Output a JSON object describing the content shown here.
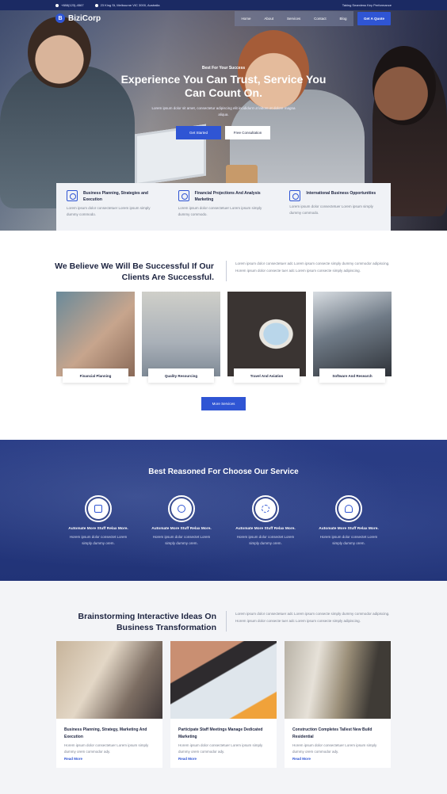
{
  "topbar": {
    "phone": "+888(123)-4567",
    "address": "23 King St, Melbourne VIC 3000, Australia",
    "tagline": "Taking Seamless Key Performance"
  },
  "nav": {
    "logo_letter": "B",
    "logo_text": "BiziCorp",
    "items": [
      "Home",
      "About",
      "Services",
      "Contact",
      "Blog"
    ],
    "cta": "Get A Quote"
  },
  "hero": {
    "eyebrow": "Best For Your Success",
    "title": "Experience You Can Trust, Service You Can Count On.",
    "subtitle": "Lorem ipsum dolor sit amet, consectetur adipiscing elit incididunt ut labore et dolore magna aliqua.",
    "primary_btn": "Get Started",
    "secondary_btn": "Free Consultation"
  },
  "features": [
    {
      "title": "Business Planning, Strategies and Execution",
      "text": "Lorem ipsum dolor consectetuer Lorem ipsum simply dummy commodo."
    },
    {
      "title": "Financial Projections And Analysis Marketing",
      "text": "Lorem ipsum dolor consectetuer Lorem ipsum simply dummy commodo."
    },
    {
      "title": "International Business Opportunities",
      "text": "Lorem ipsum dolor consectetuer Lorem ipsum simply dummy commodo."
    }
  ],
  "about": {
    "title": "We Believe We Will Be Successful If Our Clients Are Successful.",
    "text": "Lorem ipsum dolor consectetuer adc Lorem ipsum consecte simply dummy commodor adipiscing. Horem ipsum dolor consecte tuer adc Lorem ipsum consecte simply adipiscing."
  },
  "services_cards": [
    "Financial Planning",
    "Quality Resourcing",
    "Travel And Aviation",
    "Software And Research"
  ],
  "more_services_btn": "More Services",
  "choose": {
    "title": "Best Reasoned For Choose Our Service",
    "items": [
      {
        "title": "Automate More Stuff Relax More.",
        "text": "Horem ipsum dolor consectet Lorem simply dummy orem."
      },
      {
        "title": "Automate More Stuff Relax More.",
        "text": "Horem ipsum dolor consectet Lorem simply dummy orem."
      },
      {
        "title": "Automate More Stuff Relax More.",
        "text": "Horem ipsum dolor consectet Lorem simply dummy orem."
      },
      {
        "title": "Automate More Stuff Relax More.",
        "text": "Horem ipsum dolor consectet Lorem simply dummy orem."
      }
    ]
  },
  "ideas": {
    "title": "Brainstorming Interactive Ideas On Business Transformation",
    "text": "Lorem ipsum dolor consectetuer adc Lorem ipsum consecte simply dummy commodor adipiscing. Horem ipsum dolor consecte tuer adc Lorem ipsum consecte simply adipiscing."
  },
  "blog": [
    {
      "title": "Business Planning, Strategy, Marketing And Execution",
      "text": "Horem ipsum dolor consectetuer Lorem ipsum simply dummy orem commodor ady.",
      "link": "Read More"
    },
    {
      "title": "Participate Staff Meetings Manage Dedicated Marketing",
      "text": "Horem ipsum dolor consectetuer Lorem ipsum simply dummy orem commodor ady.",
      "link": "Read More"
    },
    {
      "title": "Construction Completes Tallest New Build Residential",
      "text": "Horem ipsum dolor consectetuer Lorem ipsum simply dummy orem commodor ady.",
      "link": "Read More"
    }
  ]
}
